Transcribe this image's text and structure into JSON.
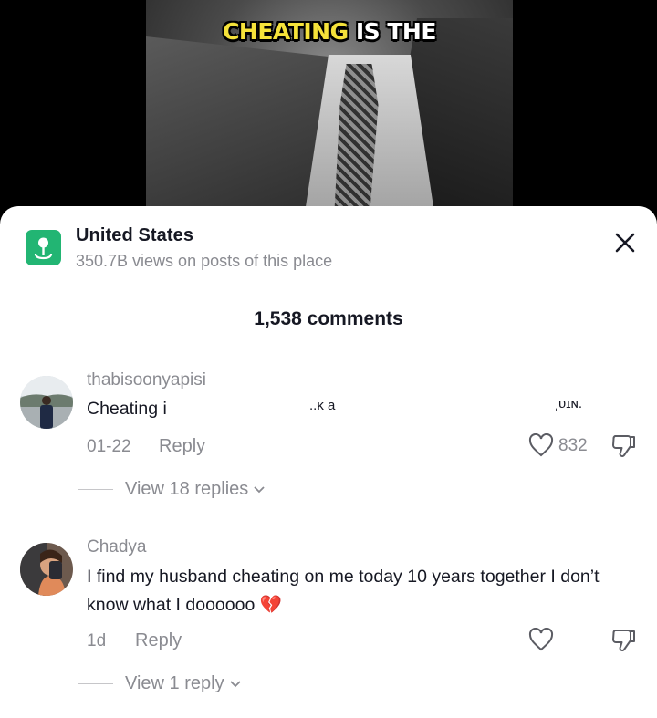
{
  "video": {
    "caption_highlight": "CHEATING",
    "caption_rest": "IS THE"
  },
  "location": {
    "icon": "map-pin-icon",
    "name": "United States",
    "views": "350.7B views on posts of this place"
  },
  "comments_header": "1,538 comments",
  "comments": [
    {
      "username": "thabisoonyapisi",
      "text": "Cheating i",
      "text_tail_fragment_1": "..ᴋ a",
      "text_tail_fragment_2": "ˌᴜɪɴ.",
      "date": "01-22",
      "reply_label": "Reply",
      "likes": "832",
      "view_replies": "View 18 replies"
    },
    {
      "username": "Chadya",
      "text": "I find my husband cheating on me today 10 years together I don’t know what I doooooo 💔",
      "date": "1d",
      "reply_label": "Reply",
      "likes": "",
      "view_replies": "View 1 reply"
    }
  ],
  "colors": {
    "accent_green": "#22b573",
    "caption_yellow": "#f5e23a",
    "text_primary": "#161823",
    "text_secondary": "#8a8b91"
  }
}
